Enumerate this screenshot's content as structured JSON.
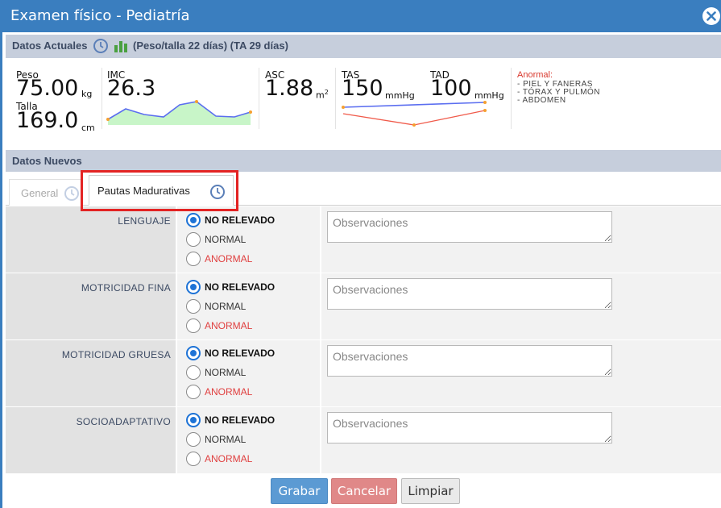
{
  "window": {
    "title": "Examen físico - Pediatría",
    "close_icon": "close-icon"
  },
  "current": {
    "section_title": "Datos Actuales",
    "extra": "(Peso/talla 22 días) (TA 29 días)",
    "peso_label": "Peso",
    "peso_value": "75.00",
    "peso_unit": "kg",
    "talla_label": "Talla",
    "talla_value": "169.0",
    "talla_unit": "cm",
    "imc_label": "IMC",
    "imc_value": "26.3",
    "asc_label": "ASC",
    "asc_value": "1.88",
    "asc_unit": "m",
    "asc_unit_sup": "2",
    "tas_label": "TAS",
    "tas_value": "150",
    "tas_unit": "mmHg",
    "tad_label": "TAD",
    "tad_value": "100",
    "tad_unit": "mmHg",
    "abnormal_title": "Anormal:",
    "abnormal_items": [
      "- PIEL Y FANERAS",
      "- TÓRAX Y PULMÓN",
      "- ABDOMEN"
    ],
    "colors": {
      "imc_line": "#5b6ef0",
      "imc_fill": "#c8f5c8",
      "tas_line": "#5b6ef0",
      "tad_line": "#f05a4a",
      "marker": "#f5a030"
    }
  },
  "new": {
    "section_title": "Datos Nuevos",
    "tabs": [
      {
        "label": "General",
        "active": false
      },
      {
        "label": "Pautas Madurativas",
        "active": true
      }
    ],
    "option_labels": [
      "NO RELEVADO",
      "NORMAL",
      "ANORMAL"
    ],
    "observaciones_placeholder": "Observaciones",
    "rows": [
      {
        "label": "LENGUAJE",
        "selected": "NO RELEVADO"
      },
      {
        "label": "MOTRICIDAD FINA",
        "selected": "NO RELEVADO"
      },
      {
        "label": "MOTRICIDAD GRUESA",
        "selected": "NO RELEVADO"
      },
      {
        "label": "SOCIOADAPTATIVO",
        "selected": "NO RELEVADO"
      }
    ]
  },
  "buttons": {
    "grabar": "Grabar",
    "cancelar": "Cancelar",
    "limpiar": "Limpiar"
  }
}
